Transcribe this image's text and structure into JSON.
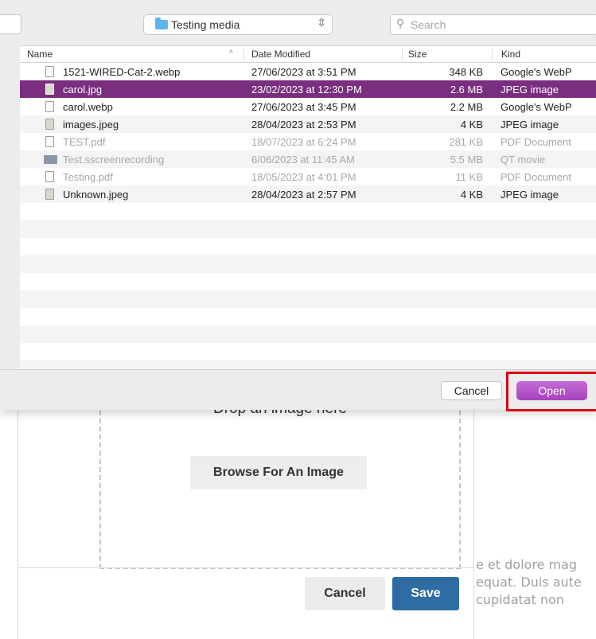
{
  "sheet": {
    "location": "Testing media",
    "search_placeholder": "Search",
    "columns": {
      "name": "Name",
      "date": "Date Modified",
      "size": "Size",
      "kind": "Kind"
    },
    "files": [
      {
        "name": "1521-WIRED-Cat-2.webp",
        "date": "27/06/2023 at 3:51 PM",
        "size": "348 KB",
        "kind": "Google's WebP",
        "icon": "webp-file-icon",
        "state": "normal"
      },
      {
        "name": "carol.jpg",
        "date": "23/02/2023 at 12:30 PM",
        "size": "2.6 MB",
        "kind": "JPEG image",
        "icon": "jpeg-file-icon",
        "state": "selected"
      },
      {
        "name": "carol.webp",
        "date": "27/06/2023 at 3:45 PM",
        "size": "2.2 MB",
        "kind": "Google's WebP",
        "icon": "webp-file-icon",
        "state": "normal"
      },
      {
        "name": "images.jpeg",
        "date": "28/04/2023 at 2:53 PM",
        "size": "4 KB",
        "kind": "JPEG image",
        "icon": "jpeg-file-icon",
        "state": "normal"
      },
      {
        "name": "TEST.pdf",
        "date": "18/07/2023 at 6:24 PM",
        "size": "281 KB",
        "kind": "PDF Document",
        "icon": "pdf-file-icon",
        "state": "disabled"
      },
      {
        "name": "Test.sscreenrecording",
        "date": "6/06/2023 at 11:45 AM",
        "size": "5.5 MB",
        "kind": "QT movie",
        "icon": "movie-file-icon",
        "state": "disabled"
      },
      {
        "name": "Testing.pdf",
        "date": "18/05/2023 at 4:01 PM",
        "size": "11 KB",
        "kind": "PDF Document",
        "icon": "pdf-file-icon",
        "state": "disabled"
      },
      {
        "name": "Unknown.jpeg",
        "date": "28/04/2023 at 2:57 PM",
        "size": "4 KB",
        "kind": "JPEG image",
        "icon": "jpeg-file-icon",
        "state": "normal"
      }
    ],
    "cancel_label": "Cancel",
    "open_label": "Open",
    "colors": {
      "selection": "#7a2e80",
      "open_button": "#a843bd",
      "highlight": "#e00010"
    }
  },
  "background": {
    "drop_text": "Drop an image here",
    "browse_label": "Browse For An Image",
    "cancel_label": "Cancel",
    "save_label": "Save",
    "editor_lines": [
      "e et dolore mag",
      "equat. Duis aute",
      "cupidatat non"
    ],
    "colors": {
      "save": "#2e6da4"
    }
  }
}
